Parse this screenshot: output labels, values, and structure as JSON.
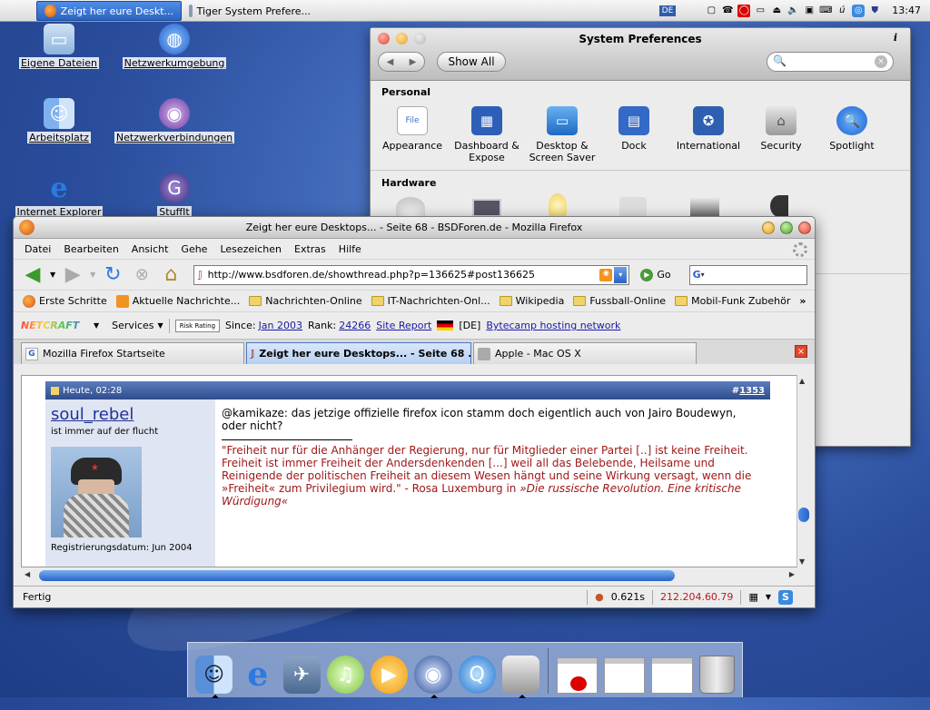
{
  "menubar": {
    "tasks": [
      {
        "label": "Zeigt her eure Deskt..."
      },
      {
        "label": "Tiger System Prefere..."
      }
    ],
    "language": "DE",
    "clock": "13:47"
  },
  "desktop_icons": [
    {
      "label": "Eigene Dateien",
      "icon": "folder-icon"
    },
    {
      "label": "Netzwerkumgebung",
      "icon": "network-globe-icon"
    },
    {
      "label": "Arbeitsplatz",
      "icon": "finder-icon"
    },
    {
      "label": "Netzwerkverbindungen",
      "icon": "network-connections-icon"
    },
    {
      "label": "Internet Explorer",
      "icon": "internet-explorer-icon"
    },
    {
      "label": "StuffIt",
      "icon": "stuffit-icon"
    }
  ],
  "syspref": {
    "title": "System Preferences",
    "show_all": "Show All",
    "info": "i",
    "search_value": "",
    "personal_label": "Personal",
    "hardware_label": "Hardware",
    "personal_items": [
      {
        "line1": "Appearance",
        "line2": "",
        "color": "#3c6fcf"
      },
      {
        "line1": "Dashboard &",
        "line2": "Expose",
        "color": "#2d5fb8"
      },
      {
        "line1": "Desktop &",
        "line2": "Screen Saver",
        "color": "#2a87d6"
      },
      {
        "line1": "Dock",
        "line2": "",
        "color": "#3469c6"
      },
      {
        "line1": "International",
        "line2": "",
        "color": "#2f5fb0"
      },
      {
        "line1": "Security",
        "line2": "",
        "color": "#9a9a9a"
      },
      {
        "line1": "Spotlight",
        "line2": "",
        "color": "#1e73e0"
      }
    ]
  },
  "firefox": {
    "title": "Zeigt her eure Desktops... - Seite 68 - BSDForen.de - Mozilla Firefox",
    "menu": [
      "Datei",
      "Bearbeiten",
      "Ansicht",
      "Gehe",
      "Lesezeichen",
      "Extras",
      "Hilfe"
    ],
    "url": "http://www.bsdforen.de/showthread.php?p=136625#post136625",
    "go": "Go",
    "bookmarks": [
      {
        "label": "Erste Schritte",
        "kind": "firefox"
      },
      {
        "label": "Aktuelle Nachrichte...",
        "kind": "rss"
      },
      {
        "label": "Nachrichten-Online",
        "kind": "folder"
      },
      {
        "label": "IT-Nachrichten-Onl...",
        "kind": "folder"
      },
      {
        "label": "Wikipedia",
        "kind": "folder"
      },
      {
        "label": "Fussball-Online",
        "kind": "folder"
      },
      {
        "label": "Mobil-Funk Zubehör",
        "kind": "folder"
      }
    ],
    "bookmarks_more": "»",
    "netcraft": {
      "logo": "NETCRAFT",
      "services": "Services",
      "risk": "Risk Rating",
      "since_label": "Since:",
      "since_value": "Jan 2003",
      "rank_label": "Rank:",
      "rank_value": "24266",
      "site_report": "Site Report",
      "country": "[DE]",
      "host": "Bytecamp hosting network"
    },
    "tabs": [
      {
        "label": "Mozilla Firefox Startseite",
        "selected": false
      },
      {
        "label": "Zeigt her eure Desktops... - Seite 68 ...",
        "selected": true
      },
      {
        "label": "Apple - Mac OS X",
        "selected": false
      }
    ],
    "post": {
      "date": "Heute, 02:28",
      "number_prefix": "#",
      "number": "1353",
      "username": "soul_rebel",
      "usertitle": "ist immer auf der flucht",
      "regdate": "Registrierungsdatum: Jun 2004",
      "message": "@kamikaze: das jetzige offizielle firefox icon stamm doch eigentlich auch von Jairo Boudewyn, oder nicht?",
      "quote": "\"Freiheit nur für die Anhänger der Regierung, nur für Mitglieder einer Partei [..] ist keine Freiheit. Freiheit ist immer Freiheit der Andersdenkenden [...] weil all das Belebende, Heilsame und Reinigende der politischen Freiheit an diesem Wesen hängt und seine Wirkung versagt, wenn die »Freiheit« zum Privilegium wird.\" - Rosa Luxemburg in ",
      "quote_source": "»Die russische Revolution. Eine kritische Würdigung«"
    },
    "status": {
      "text": "Fertig",
      "load_time": "0.621s",
      "ip": "212.204.60.79"
    }
  },
  "dock": {
    "apps": [
      {
        "name": "finder-icon",
        "color": "#5a8fd8",
        "running": true
      },
      {
        "name": "internet-explorer-icon",
        "color": "#2a6fd0",
        "running": false
      },
      {
        "name": "mail-icon",
        "color": "#6b86a8",
        "running": false
      },
      {
        "name": "itunes-icon",
        "color": "#9ccf55",
        "running": false
      },
      {
        "name": "media-player-icon",
        "color": "#f0a020",
        "running": false
      },
      {
        "name": "dvd-player-icon",
        "color": "#2a4f9a",
        "running": true
      },
      {
        "name": "quicktime-icon",
        "color": "#3a8ae0",
        "running": false
      },
      {
        "name": "system-preferences-icon",
        "color": "#9a9a9a",
        "running": true
      }
    ]
  }
}
